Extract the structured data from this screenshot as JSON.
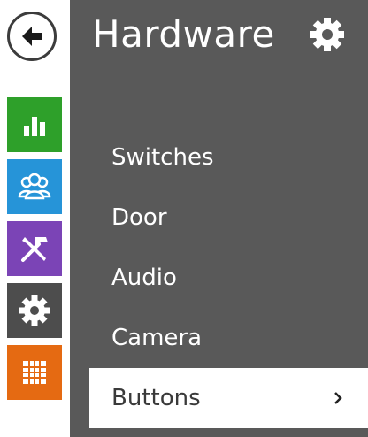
{
  "header": {
    "title": "Hardware",
    "back_icon": "arrow-left-icon",
    "settings_icon": "gear-icon"
  },
  "nav_rail": {
    "items": [
      {
        "id": "status",
        "icon": "bar-chart-icon",
        "color": "#2ea02a"
      },
      {
        "id": "users",
        "icon": "users-icon",
        "color": "#2694d8"
      },
      {
        "id": "hardware",
        "icon": "tools-icon",
        "color": "#7b44b6"
      },
      {
        "id": "system",
        "icon": "gear-icon",
        "color": "#4d4d4d"
      },
      {
        "id": "services",
        "icon": "grid-icon",
        "color": "#e56a12"
      }
    ]
  },
  "menu": {
    "items": [
      {
        "label": "Switches",
        "active": false
      },
      {
        "label": "Door",
        "active": false
      },
      {
        "label": "Audio",
        "active": false
      },
      {
        "label": "Camera",
        "active": false
      },
      {
        "label": "Buttons",
        "active": true
      }
    ]
  },
  "colors": {
    "panel_bg": "#595959",
    "active_item_bg": "#ffffff",
    "text": "#ffffff"
  }
}
